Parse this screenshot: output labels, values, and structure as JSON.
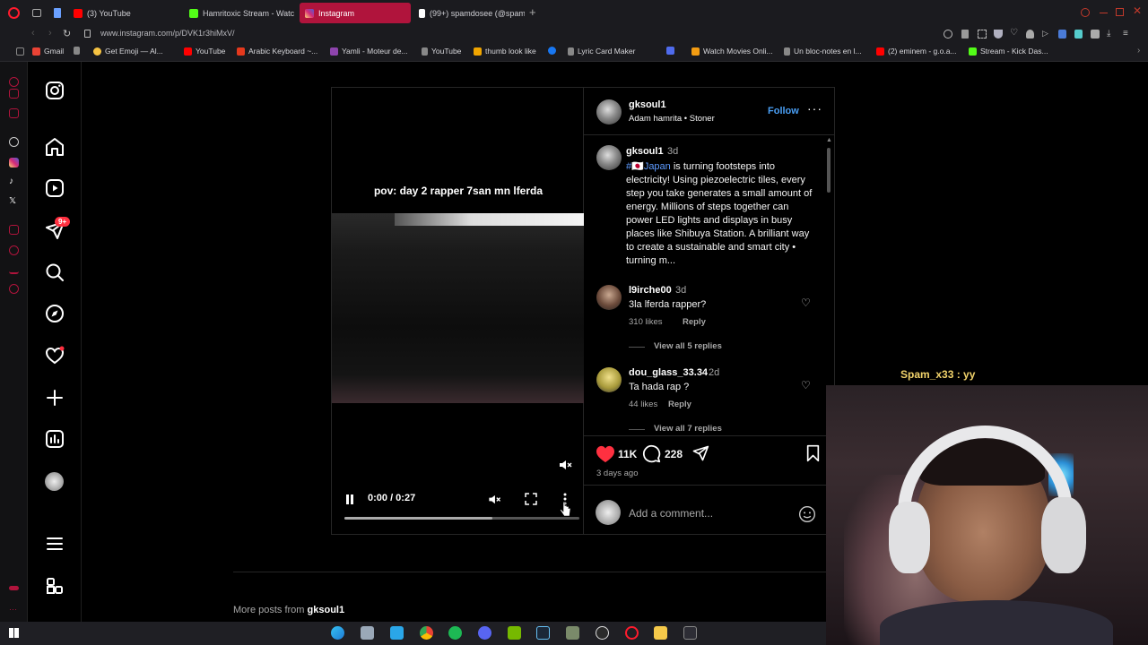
{
  "browser": {
    "tabs": [
      {
        "label": "(3) YouTube",
        "color": "#ff0000",
        "active": false
      },
      {
        "label": "Hamritoxic Stream - Watc",
        "color": "#53fc18",
        "active": false
      },
      {
        "label": "Instagram",
        "color": "#e1306c",
        "active": true
      },
      {
        "label": "(99+) spamdosee (@spam",
        "color": "#ffffff",
        "active": false
      }
    ],
    "url": "www.instagram.com/p/DVK1r3hiMxV/",
    "bookmarks": [
      {
        "label": "Gmail",
        "color": "#ea4335"
      },
      {
        "label": "",
        "color": "#888888"
      },
      {
        "label": "Get Emoji — Al...",
        "color": "#f6c343"
      },
      {
        "label": "YouTube",
        "color": "#ff0000"
      },
      {
        "label": "Arabic Keyboard ~...",
        "color": "#e5391d"
      },
      {
        "label": "Yamli - Moteur de...",
        "color": "#8e44ad"
      },
      {
        "label": "YouTube",
        "color": "#888888"
      },
      {
        "label": "thumb look like",
        "color": "#f0a500"
      },
      {
        "label": "",
        "color": "#1877f2"
      },
      {
        "label": "Lyric Card Maker",
        "color": "#888888"
      },
      {
        "label": "",
        "color": "#4f6bed"
      },
      {
        "label": "Watch Movies Onli...",
        "color": "#f39c12"
      },
      {
        "label": "Un bloc-notes en l...",
        "color": "#888888"
      },
      {
        "label": "(2) eminem - g.o.a...",
        "color": "#ff0000"
      },
      {
        "label": "Stream - Kick Das...",
        "color": "#53fc18"
      }
    ]
  },
  "nav": {
    "notif_badge": "9+"
  },
  "video": {
    "caption": "pov: day 2 rapper 7san mn lferda",
    "time": "0:00 / 0:27",
    "progress": 0.0
  },
  "post": {
    "author": "gksoul1",
    "subtitle": "Adam hamrita • Stoner",
    "follow_label": "Follow",
    "caption_author": "gksoul1",
    "caption_age": "3d",
    "caption_hashtag": "#🇯🇵Japan",
    "caption_text": " is turning footsteps into electricity! Using piezoelectric tiles, every step you take generates a small amount of energy. Millions of steps together can power LED lights and displays in busy places like Shibuya Station. A brilliant way to create a sustainable and smart city • turning m...",
    "comments": [
      {
        "user": "l9irche00",
        "age": "3d",
        "text": "3la lferda rapper?",
        "likes": "310 likes",
        "reply": "Reply",
        "view_replies": "View all 5 replies"
      },
      {
        "user": "dou_glass_33.34",
        "age": "2d",
        "text": "Ta hada rap ?",
        "likes": "44 likes",
        "reply": "Reply",
        "view_replies": "View all 7 replies"
      }
    ],
    "like_count": "11K",
    "comment_count": "228",
    "posted": "3 days ago",
    "add_comment_placeholder": "Add a comment..."
  },
  "more_posts": {
    "label": "More posts from",
    "user": "gksoul1"
  },
  "stream_overlay": "Spam_x33 : yy"
}
